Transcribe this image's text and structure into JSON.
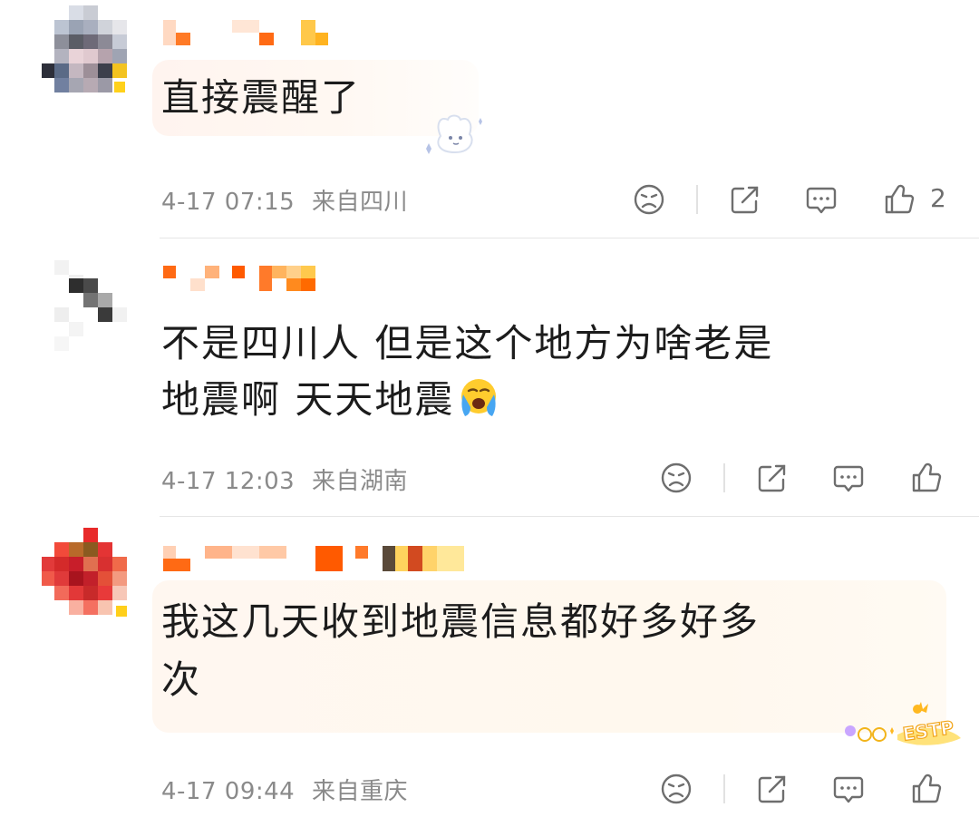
{
  "comments": [
    {
      "text": "直接震醒了",
      "date": "4-17 07:15",
      "location": "来自四川",
      "like_count": "2"
    },
    {
      "text_line1": "不是四川人 但是这个地方为啥老是",
      "text_line2": "地震啊 天天地震",
      "emoji": "loudly-crying-face",
      "date": "4-17 12:03",
      "location": "来自湖南",
      "like_count": ""
    },
    {
      "text_line1": "我这几天收到地震信息都好多好多",
      "text_line2": "次",
      "date": "4-17 09:44",
      "location": "来自重庆",
      "like_count": "",
      "badge_text": "ESTP"
    }
  ],
  "colors": {
    "text": "#1c1c1c",
    "meta": "#8a8a8a",
    "icon": "#6e6e6e",
    "nickname_pixel": "#ff7b2e"
  },
  "icons": [
    "dislike-face-icon",
    "repost-icon",
    "comment-icon",
    "like-icon"
  ]
}
